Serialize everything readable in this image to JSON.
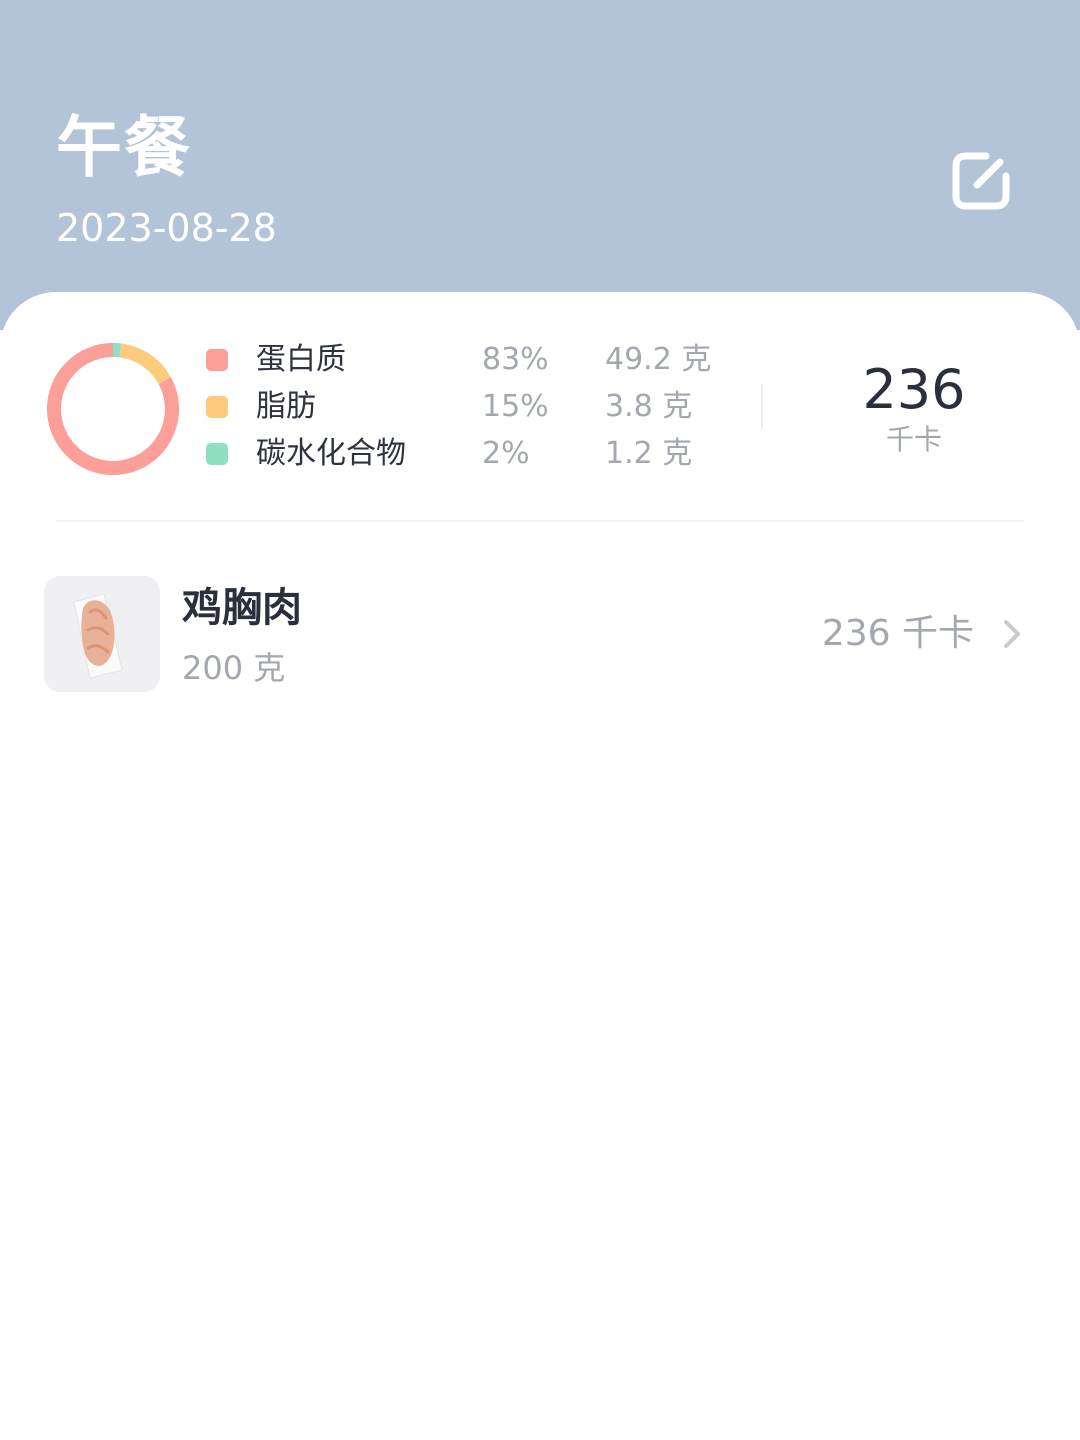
{
  "header": {
    "title": "午餐",
    "date": "2023-08-28",
    "background_color": "#b3c4d9",
    "edit_icon": "edit-icon"
  },
  "summary": {
    "macros": [
      {
        "name": "蛋白质",
        "percent": "83%",
        "grams": "49.2 克",
        "color": "#fb9f98"
      },
      {
        "name": "脂肪",
        "percent": "15%",
        "grams": "3.8 克",
        "color": "#fdcb7c"
      },
      {
        "name": "碳水化合物",
        "percent": "2%",
        "grams": "1.2 克",
        "color": "#8ee0c0"
      }
    ],
    "total_kcal": "236",
    "total_unit": "千卡",
    "donut_shares": [
      83,
      15,
      2
    ]
  },
  "foods": [
    {
      "name": "鸡胸肉",
      "weight": "200 克",
      "kcal": "236 千卡",
      "thumbnail_icon": "chicken-breast-photo",
      "chevron_icon": "chevron-right-icon"
    }
  ]
}
